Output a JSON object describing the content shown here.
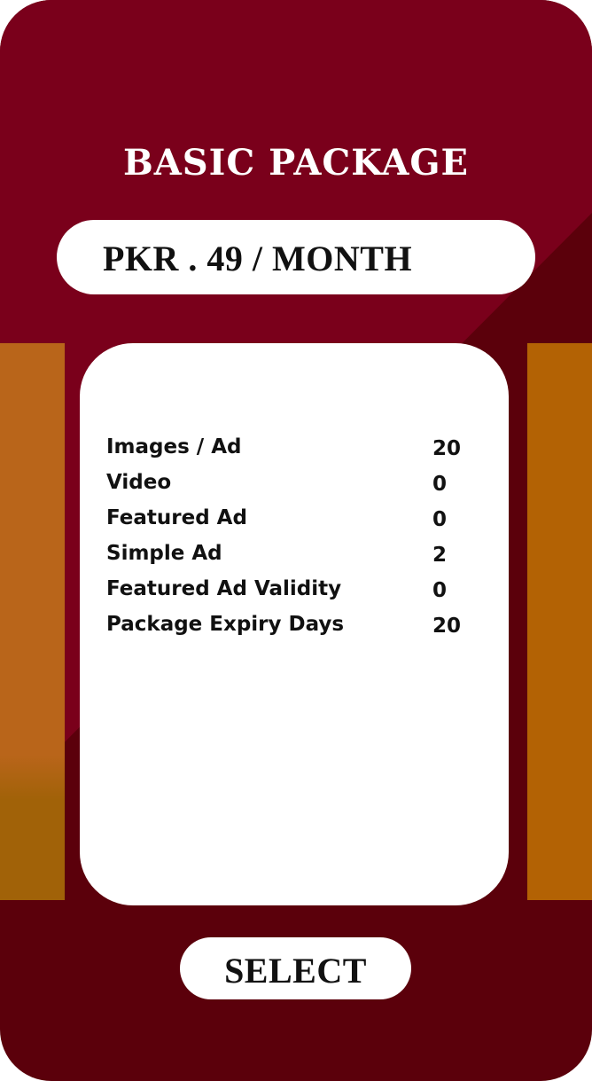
{
  "package": {
    "title": "BASIC PACKAGE",
    "price": "PKR . 49 / MONTH"
  },
  "features": [
    {
      "label": "Images / Ad",
      "value": "20"
    },
    {
      "label": "Video",
      "value": "0"
    },
    {
      "label": "Featured Ad",
      "value": "0"
    },
    {
      "label": "Simple Ad",
      "value": "2"
    },
    {
      "label": "Featured Ad Validity",
      "value": "0"
    },
    {
      "label": "Package Expiry Days",
      "value": "20"
    }
  ],
  "actions": {
    "select_label": "SELECT"
  },
  "colors": {
    "card_dark": "#5b000b",
    "card_light": "#7a001b",
    "accent_left": "#b9651a",
    "accent_right": "#b36204",
    "panel": "#ffffff"
  }
}
